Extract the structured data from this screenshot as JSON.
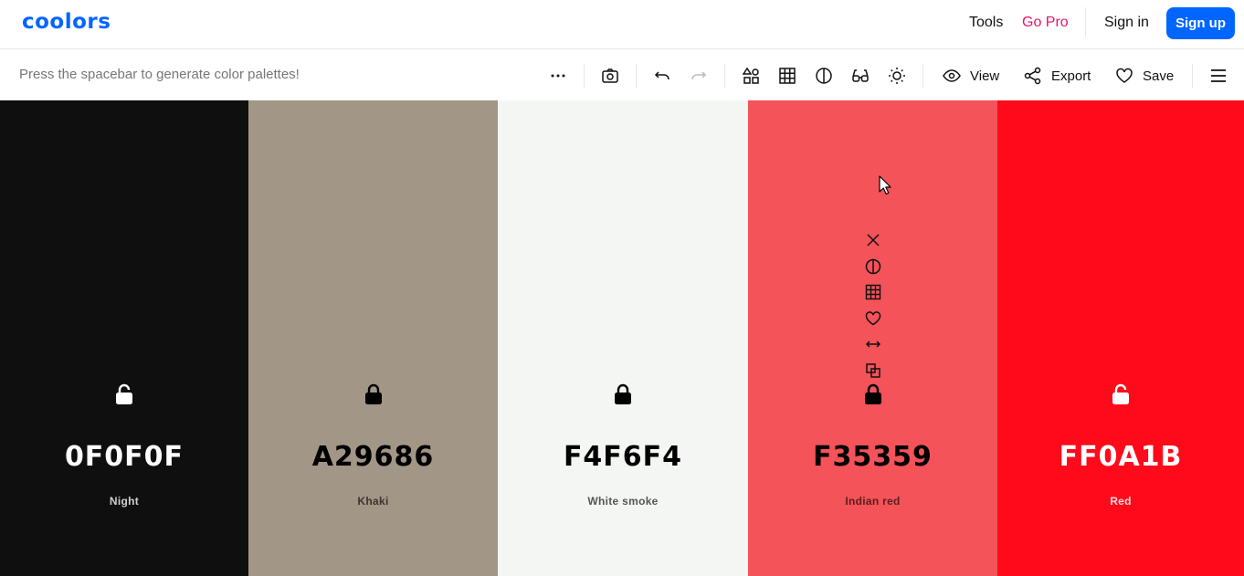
{
  "nav": {
    "logo": "coolors",
    "tools": "Tools",
    "go_pro": "Go Pro",
    "sign_in": "Sign in",
    "sign_up": "Sign up"
  },
  "toolbar": {
    "hint": "Press the spacebar to generate color palettes!",
    "icons": [
      "more-icon",
      "camera-icon",
      "undo-icon",
      "redo-icon",
      "shapes-icon",
      "grid-icon",
      "contrast-icon",
      "glasses-icon",
      "brightness-icon"
    ],
    "view": "View",
    "export": "Export",
    "save": "Save",
    "menu_icon": "menu-icon"
  },
  "palette": [
    {
      "hex": "0F0F0F",
      "name": "Night",
      "color": "#0F0F0F",
      "text_color": "#ffffff",
      "name_color": "#cfcfcf",
      "locked": false
    },
    {
      "hex": "A29686",
      "name": "Khaki",
      "color": "#A29686",
      "text_color": "#000000",
      "name_color": "#3b3530",
      "locked": true
    },
    {
      "hex": "F4F6F4",
      "name": "White smoke",
      "color": "#F4F6F4",
      "text_color": "#000000",
      "name_color": "#555555",
      "locked": true
    },
    {
      "hex": "F35359",
      "name": "Indian red",
      "color": "#F35359",
      "text_color": "#000000",
      "name_color": "#5a1e20",
      "locked": true
    },
    {
      "hex": "FF0A1B",
      "name": "Red",
      "color": "#FF0A1B",
      "text_color": "#ffffff",
      "name_color": "#ffd9dc",
      "locked": false
    }
  ],
  "swatch_tools": [
    "close-icon",
    "contrast-icon",
    "grid-icon",
    "heart-icon",
    "drag-arrows-icon",
    "copy-icon"
  ],
  "colors": {
    "brand": "#0066ff",
    "go_pro": "#e5166f"
  }
}
